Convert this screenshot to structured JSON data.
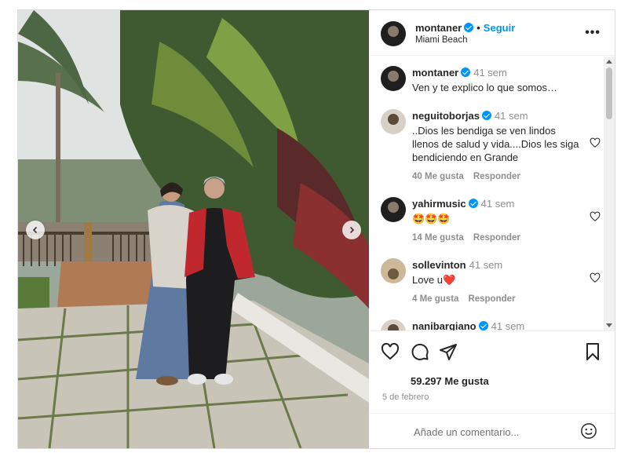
{
  "post": {
    "username": "montaner",
    "follow_label": "Seguir",
    "location": "Miami Beach",
    "more_label": "•••"
  },
  "comments": [
    {
      "user": "montaner",
      "time": "41 sem",
      "text": "Ven y te explico lo que somos…",
      "likes": "",
      "reply": ""
    },
    {
      "user": "neguitoborjas",
      "time": "41 sem",
      "text": "..Dios les bendiga se ven lindos llenos de salud y vida....Dios les siga bendiciendo en Grande",
      "likes": "40 Me gusta",
      "reply": "Responder"
    },
    {
      "user": "yahirmusic",
      "time": "41 sem",
      "text": "🤩🤩🤩",
      "likes": "14 Me gusta",
      "reply": "Responder"
    },
    {
      "user": "sollevinton",
      "time": "41 sem",
      "text": "Love u❤️",
      "likes": "4 Me gusta",
      "reply": "Responder"
    },
    {
      "user": "nanibargiano",
      "time": "41 sem",
      "text": "",
      "likes": "",
      "reply": ""
    }
  ],
  "footer": {
    "likes": "59.297 Me gusta",
    "date": "5 de febrero",
    "comment_placeholder": "Añade un comentario..."
  },
  "icons": {
    "like": "heart-icon",
    "comment": "comment-icon",
    "share": "share-icon",
    "save": "bookmark-icon",
    "emoji": "emoji-icon"
  },
  "colors": {
    "accent": "#0095f6",
    "muted": "#8e8e8e"
  }
}
